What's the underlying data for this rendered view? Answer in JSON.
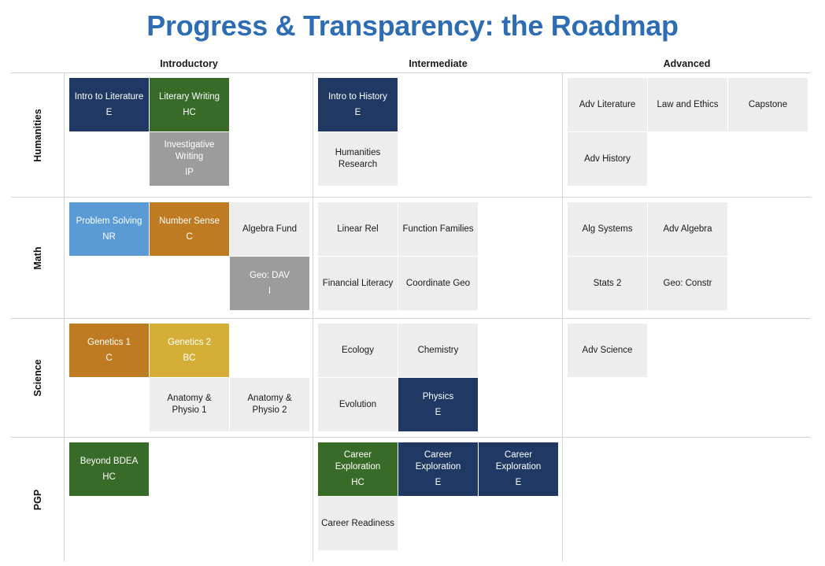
{
  "title": "Progress & Transparency: the Roadmap",
  "columns": [
    {
      "label": "Introductory"
    },
    {
      "label": "Intermediate"
    },
    {
      "label": "Advanced"
    }
  ],
  "colors": {
    "grey": "#EDEDED",
    "navy": "#1F3864",
    "green": "#386B28",
    "medium_grey": "#9C9C9C",
    "light_blue": "#5B9BD5",
    "orange": "#BF7B21",
    "gold": "#D4AE37",
    "title_blue": "#2E6DB4"
  },
  "rows": [
    {
      "label": "Humanities",
      "sections": [
        {
          "column": "Introductory",
          "cards": [
            {
              "name": "Intro to Literature",
              "code": "E",
              "color": "navy"
            },
            {
              "name": "Literary Writing",
              "code": "HC",
              "color": "green"
            },
            {
              "name": "",
              "code": "",
              "color": "empty"
            },
            {
              "name": "",
              "code": "",
              "color": "empty"
            },
            {
              "name": "Investigative Writing",
              "code": "IP",
              "color": "mgrey"
            },
            {
              "name": "",
              "code": "",
              "color": "empty"
            }
          ]
        },
        {
          "column": "Intermediate",
          "cards": [
            {
              "name": "Intro to History",
              "code": "E",
              "color": "navy"
            },
            {
              "name": "",
              "code": "",
              "color": "empty"
            },
            {
              "name": "",
              "code": "",
              "color": "empty"
            },
            {
              "name": "Humanities Research",
              "code": "",
              "color": "grey"
            },
            {
              "name": "",
              "code": "",
              "color": "empty"
            },
            {
              "name": "",
              "code": "",
              "color": "empty"
            }
          ]
        },
        {
          "column": "Advanced",
          "cards": [
            {
              "name": "Adv Literature",
              "code": "",
              "color": "grey"
            },
            {
              "name": "Law and Ethics",
              "code": "",
              "color": "grey"
            },
            {
              "name": "Capstone",
              "code": "",
              "color": "grey"
            },
            {
              "name": "Adv History",
              "code": "",
              "color": "grey"
            },
            {
              "name": "",
              "code": "",
              "color": "empty"
            },
            {
              "name": "",
              "code": "",
              "color": "empty"
            }
          ]
        }
      ]
    },
    {
      "label": "Math",
      "sections": [
        {
          "column": "Introductory",
          "cards": [
            {
              "name": "Problem Solving",
              "code": "NR",
              "color": "blue"
            },
            {
              "name": "Number Sense",
              "code": "C",
              "color": "orange"
            },
            {
              "name": "Algebra Fund",
              "code": "",
              "color": "grey"
            },
            {
              "name": "",
              "code": "",
              "color": "empty"
            },
            {
              "name": "",
              "code": "",
              "color": "empty"
            },
            {
              "name": "Geo: DAV",
              "code": "I",
              "color": "mgrey"
            }
          ]
        },
        {
          "column": "Intermediate",
          "cards": [
            {
              "name": "Linear Rel",
              "code": "",
              "color": "grey"
            },
            {
              "name": "Function Families",
              "code": "",
              "color": "grey"
            },
            {
              "name": "",
              "code": "",
              "color": "empty"
            },
            {
              "name": "Financial Literacy",
              "code": "",
              "color": "grey"
            },
            {
              "name": "Coordinate Geo",
              "code": "",
              "color": "grey"
            },
            {
              "name": "",
              "code": "",
              "color": "empty"
            }
          ]
        },
        {
          "column": "Advanced",
          "cards": [
            {
              "name": "Alg Systems",
              "code": "",
              "color": "grey"
            },
            {
              "name": "Adv Algebra",
              "code": "",
              "color": "grey"
            },
            {
              "name": "",
              "code": "",
              "color": "empty"
            },
            {
              "name": "Stats 2",
              "code": "",
              "color": "grey"
            },
            {
              "name": "Geo: Constr",
              "code": "",
              "color": "grey"
            },
            {
              "name": "",
              "code": "",
              "color": "empty"
            }
          ]
        }
      ]
    },
    {
      "label": "Science",
      "sections": [
        {
          "column": "Introductory",
          "cards": [
            {
              "name": "Genetics 1",
              "code": "C",
              "color": "orange"
            },
            {
              "name": "Genetics 2",
              "code": "BC",
              "color": "gold"
            },
            {
              "name": "",
              "code": "",
              "color": "empty"
            },
            {
              "name": "",
              "code": "",
              "color": "empty"
            },
            {
              "name": "Anatomy & Physio 1",
              "code": "",
              "color": "grey"
            },
            {
              "name": "Anatomy & Physio 2",
              "code": "",
              "color": "grey"
            }
          ]
        },
        {
          "column": "Intermediate",
          "cards": [
            {
              "name": "Ecology",
              "code": "",
              "color": "grey"
            },
            {
              "name": "Chemistry",
              "code": "",
              "color": "grey"
            },
            {
              "name": "",
              "code": "",
              "color": "empty"
            },
            {
              "name": "Evolution",
              "code": "",
              "color": "grey"
            },
            {
              "name": "Physics",
              "code": "E",
              "color": "navy"
            },
            {
              "name": "",
              "code": "",
              "color": "empty"
            }
          ]
        },
        {
          "column": "Advanced",
          "cards": [
            {
              "name": "Adv Science",
              "code": "",
              "color": "grey"
            },
            {
              "name": "",
              "code": "",
              "color": "empty"
            },
            {
              "name": "",
              "code": "",
              "color": "empty"
            },
            {
              "name": "",
              "code": "",
              "color": "empty"
            },
            {
              "name": "",
              "code": "",
              "color": "empty"
            },
            {
              "name": "",
              "code": "",
              "color": "empty"
            }
          ]
        }
      ]
    },
    {
      "label": "PGP",
      "sections": [
        {
          "column": "Introductory",
          "cards": [
            {
              "name": "Beyond BDEA",
              "code": "HC",
              "color": "green"
            },
            {
              "name": "",
              "code": "",
              "color": "empty"
            },
            {
              "name": "",
              "code": "",
              "color": "empty"
            },
            {
              "name": "",
              "code": "",
              "color": "empty"
            },
            {
              "name": "",
              "code": "",
              "color": "empty"
            },
            {
              "name": "",
              "code": "",
              "color": "empty"
            }
          ]
        },
        {
          "column": "Intermediate",
          "cards": [
            {
              "name": "Career Exploration",
              "code": "HC",
              "color": "green"
            },
            {
              "name": "Career Exploration",
              "code": "E",
              "color": "navy"
            },
            {
              "name": "Career Exploration",
              "code": "E",
              "color": "navy"
            },
            {
              "name": "Career Readiness",
              "code": "",
              "color": "grey"
            },
            {
              "name": "",
              "code": "",
              "color": "empty"
            },
            {
              "name": "",
              "code": "",
              "color": "empty"
            }
          ]
        },
        {
          "column": "Advanced",
          "cards": [
            {
              "name": "",
              "code": "",
              "color": "empty"
            },
            {
              "name": "",
              "code": "",
              "color": "empty"
            },
            {
              "name": "",
              "code": "",
              "color": "empty"
            },
            {
              "name": "",
              "code": "",
              "color": "empty"
            },
            {
              "name": "",
              "code": "",
              "color": "empty"
            },
            {
              "name": "",
              "code": "",
              "color": "empty"
            }
          ]
        }
      ]
    }
  ]
}
